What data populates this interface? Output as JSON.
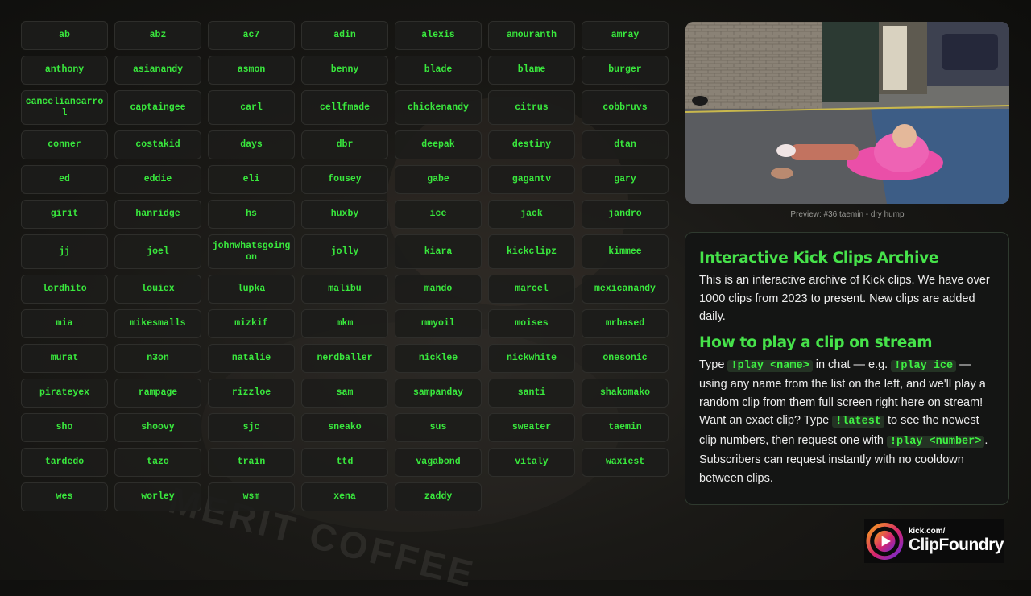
{
  "names": [
    "ab",
    "abz",
    "ac7",
    "adin",
    "alexis",
    "amouranth",
    "amray",
    "anthony",
    "asianandy",
    "asmon",
    "benny",
    "blade",
    "blame",
    "burger",
    "canceliancarrol",
    "captaingee",
    "carl",
    "cellfmade",
    "chickenandy",
    "citrus",
    "cobbruvs",
    "conner",
    "costakid",
    "days",
    "dbr",
    "deepak",
    "destiny",
    "dtan",
    "ed",
    "eddie",
    "eli",
    "fousey",
    "gabe",
    "gagantv",
    "gary",
    "girit",
    "hanridge",
    "hs",
    "huxby",
    "ice",
    "jack",
    "jandro",
    "jj",
    "joel",
    "johnwhatsgoingon",
    "jolly",
    "kiara",
    "kickclipz",
    "kimmee",
    "lordhito",
    "louiex",
    "lupka",
    "malibu",
    "mando",
    "marcel",
    "mexicanandy",
    "mia",
    "mikesmalls",
    "mizkif",
    "mkm",
    "mmyoil",
    "moises",
    "mrbased",
    "murat",
    "n3on",
    "natalie",
    "nerdballer",
    "nicklee",
    "nickwhite",
    "onesonic",
    "pirateyex",
    "rampage",
    "rizzloe",
    "sam",
    "sampanday",
    "santi",
    "shakomako",
    "sho",
    "shoovy",
    "sjc",
    "sneako",
    "sus",
    "sweater",
    "taemin",
    "tardedo",
    "tazo",
    "train",
    "ttd",
    "vagabond",
    "vitaly",
    "waxiest",
    "wes",
    "worley",
    "wsm",
    "xena",
    "zaddy"
  ],
  "preview": {
    "caption": "Preview: #36 taemin - dry hump"
  },
  "info": {
    "title": "Interactive Kick Clips Archive",
    "description": "This is an interactive archive of Kick clips. We have over 1000 clips from 2023 to present. New clips are added daily.",
    "howto_title": "How to play a clip on stream",
    "t1": "Type ",
    "c1": "!play <name>",
    "t2": " in chat — e.g. ",
    "c2": "!play ice",
    "t3": " — using any name from the list on the left, and we'll play a random clip from them full screen right here on stream! Want an exact clip? Type ",
    "c3": "!latest",
    "t4": " to see the newest clip numbers, then request one with ",
    "c4": "!play <number>",
    "t5": ". Subscribers can request instantly with no cooldown between clips."
  },
  "logo": {
    "small": "kick.com/",
    "big_first": "Clip",
    "big_second": "Foundry"
  },
  "background_text": "MERIT COFFEE",
  "colors": {
    "accent": "#39e83d",
    "panel": "#141514",
    "logo_gradient": [
      "#f9a21b",
      "#d6246e",
      "#6b2bd8"
    ]
  }
}
